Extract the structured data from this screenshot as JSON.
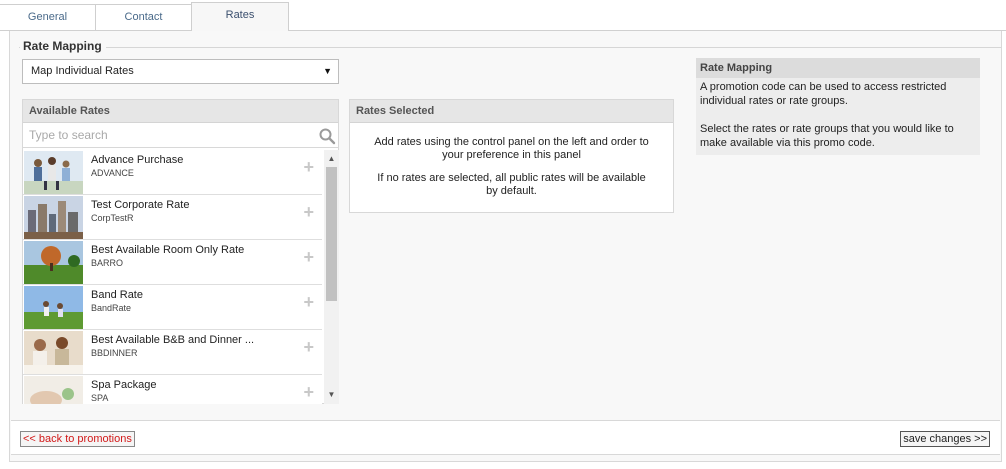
{
  "tabs": [
    {
      "label": "General",
      "active": false
    },
    {
      "label": "Contact",
      "active": false
    },
    {
      "label": "Rates",
      "active": true
    }
  ],
  "rate_mapping": {
    "legend": "Rate Mapping",
    "mode_select": {
      "value": "Map Individual Rates"
    }
  },
  "available_rates": {
    "header": "Available Rates",
    "search_placeholder": "Type to search",
    "items": [
      {
        "name": "Advance Purchase",
        "code": "ADVANCE"
      },
      {
        "name": "Test Corporate Rate",
        "code": "CorpTestR"
      },
      {
        "name": "Best Available Room Only Rate",
        "code": "BARRO"
      },
      {
        "name": "Band Rate",
        "code": "BandRate"
      },
      {
        "name": "Best Available B&B and Dinner ...",
        "code": "BBDINNER"
      },
      {
        "name": "Spa Package",
        "code": "SPA"
      }
    ],
    "add_symbol": "+"
  },
  "rates_selected": {
    "header": "Rates Selected",
    "line1": "Add rates using the control panel on the left and order to your preference in this panel",
    "line2": "If no rates are selected, all public rates will be available by default."
  },
  "help": {
    "title": "Rate Mapping",
    "para1": "A promotion code can be used to access restricted individual rates or rate groups.",
    "para2": "Select the rates or rate groups that you would like to make available via this promo code."
  },
  "footer": {
    "back_label": "<< back to promotions",
    "save_label": "save changes >>"
  },
  "colors": {
    "back_link": "#d21a1a",
    "tab_text": "#4a6a8a",
    "panel_header_bg": "#e6e6e6"
  }
}
